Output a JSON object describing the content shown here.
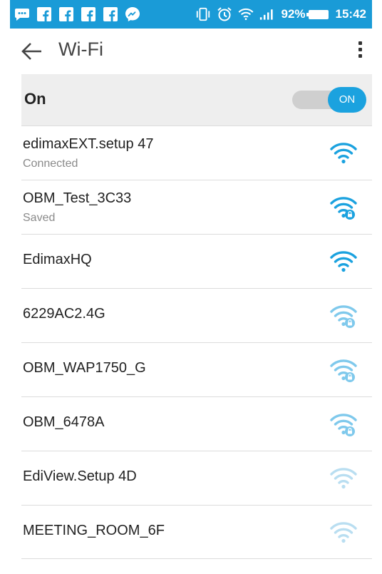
{
  "status_bar": {
    "battery": "92%",
    "time": "15:42",
    "left_icons": [
      "message-icon",
      "facebook-icon",
      "facebook-icon",
      "facebook-icon",
      "facebook-icon",
      "messenger-icon"
    ],
    "right_icons": [
      "vibrate-icon",
      "alarm-icon",
      "wifi-icon",
      "signal-icon",
      "battery-icon"
    ]
  },
  "appbar": {
    "title": "Wi-Fi"
  },
  "master_switch": {
    "label": "On",
    "state": "ON"
  },
  "networks": [
    {
      "ssid": "edimaxEXT.setup 47",
      "status": "Connected",
      "signal": "full",
      "secured": false
    },
    {
      "ssid": "OBM_Test_3C33",
      "status": "Saved",
      "signal": "full",
      "secured": true
    },
    {
      "ssid": "EdimaxHQ",
      "status": "",
      "signal": "full",
      "secured": false
    },
    {
      "ssid": "6229AC2.4G",
      "status": "",
      "signal": "medium",
      "secured": true
    },
    {
      "ssid": "OBM_WAP1750_G",
      "status": "",
      "signal": "medium",
      "secured": true
    },
    {
      "ssid": "OBM_6478A",
      "status": "",
      "signal": "medium",
      "secured": true
    },
    {
      "ssid": "EdiView.Setup 4D",
      "status": "",
      "signal": "low",
      "secured": false
    },
    {
      "ssid": "MEETING_ROOM_6F",
      "status": "",
      "signal": "low",
      "secured": false
    }
  ],
  "colors": {
    "accent": "#1a9bd7",
    "icon_full": "#1ba2df",
    "icon_medium": "#7fc9ec",
    "icon_low": "#b9def1"
  }
}
